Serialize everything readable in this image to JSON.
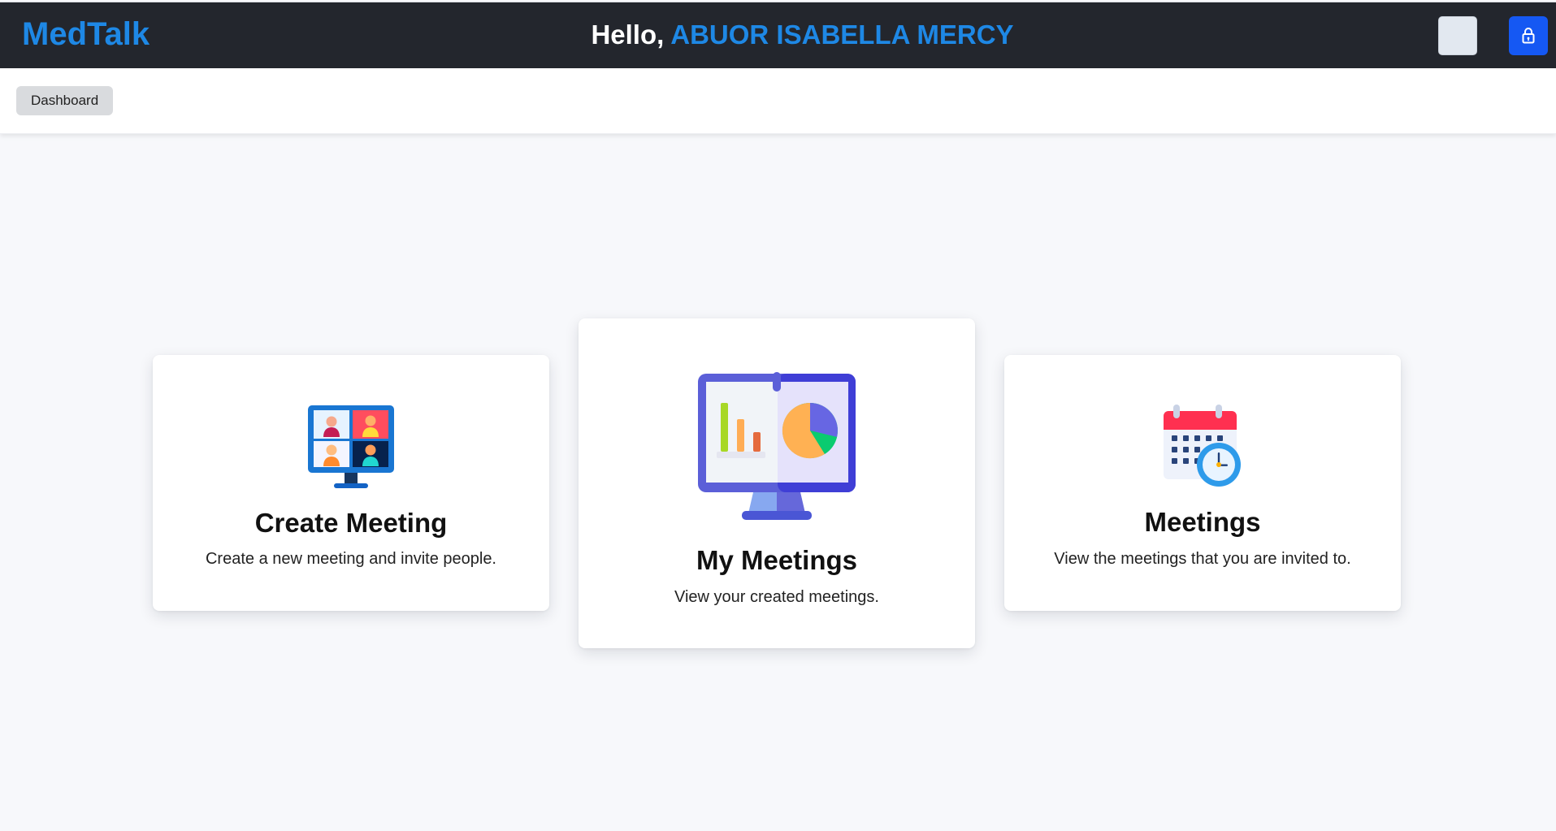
{
  "header": {
    "brand": "MedTalk",
    "greeting_prefix": "Hello,",
    "user_name": "ABUOR ISABELLA MERCY"
  },
  "subnav": {
    "breadcrumb_label": "Dashboard"
  },
  "cards": [
    {
      "title": "Create Meeting",
      "description": "Create a new meeting and invite people.",
      "icon": "video-conference-monitor-icon"
    },
    {
      "title": "My Meetings",
      "description": "View your created meetings.",
      "icon": "analytics-monitor-icon"
    },
    {
      "title": "Meetings",
      "description": "View the meetings that you are invited to.",
      "icon": "calendar-clock-icon"
    }
  ],
  "colors": {
    "topbar_background": "#23262d",
    "brand_blue": "#1e88e5",
    "lock_button_blue": "#1558f3",
    "page_background": "#f7f8fb"
  }
}
